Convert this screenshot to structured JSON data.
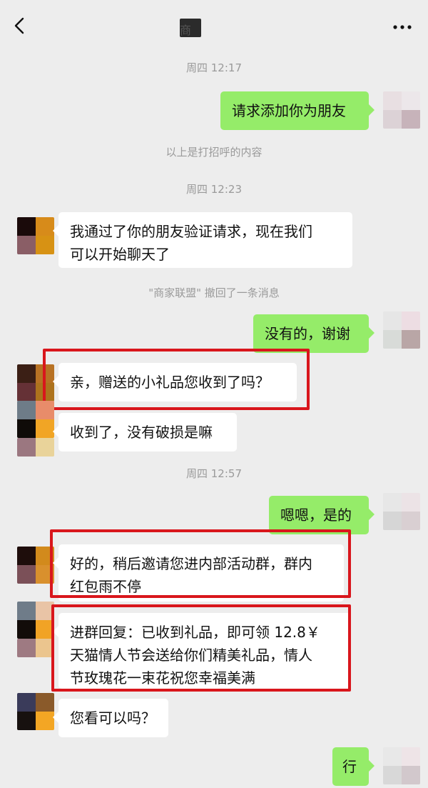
{
  "header": {
    "title": "商",
    "back_icon": "chevron-left-icon",
    "more_icon": "ellipsis-icon"
  },
  "timestamps": [
    "周四 12:17",
    "周四 12:23",
    "周四 12:57"
  ],
  "system": {
    "greeting_note": "以上是打招呼的内容",
    "recall_note": "\"商家联盟\" 撤回了一条消息"
  },
  "messages": [
    {
      "side": "out",
      "text": "请求添加你为朋友"
    },
    {
      "side": "in",
      "text": "我通过了你的朋友验证请求，现在我们\n可以开始聊天了"
    },
    {
      "side": "out",
      "text": "没有的，谢谢"
    },
    {
      "side": "in",
      "text": "亲，赠送的小礼品您收到了吗？"
    },
    {
      "side": "in",
      "text": "收到了，没有破损是嘛"
    },
    {
      "side": "out",
      "text": "嗯嗯，是的"
    },
    {
      "side": "in",
      "text": "好的，稍后邀请您进内部活动群，群内\n红包雨不停"
    },
    {
      "side": "in",
      "text": "进群回复：已收到礼品，即可领 12.8￥\n天猫情人节会送给你们精美礼品，情人\n节玫瑰花一束花祝您幸福美满"
    },
    {
      "side": "in",
      "text": "您看可以吗？"
    },
    {
      "side": "out",
      "text": "行"
    }
  ],
  "colors": {
    "background": "#ededed",
    "outgoing_bubble": "#95ec69",
    "incoming_bubble": "#ffffff",
    "highlight_box": "#d9161c"
  }
}
